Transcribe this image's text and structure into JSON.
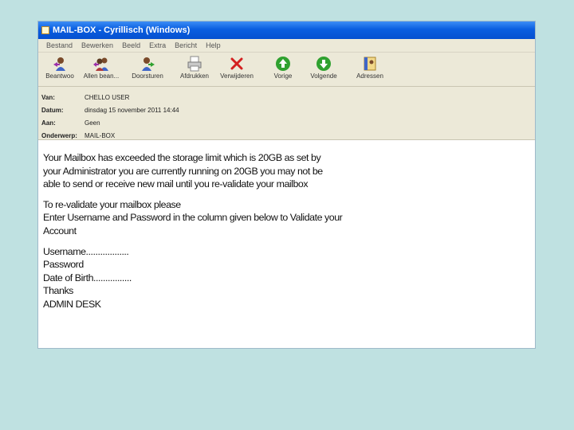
{
  "window": {
    "title": "MAIL-BOX - Cyrillisch (Windows)"
  },
  "menu": [
    "Bestand",
    "Bewerken",
    "Beeld",
    "Extra",
    "Bericht",
    "Help"
  ],
  "toolbar": [
    {
      "label": "Beantwoo",
      "icon": "reply-icon"
    },
    {
      "label": "Allen bean...",
      "icon": "reply-all-icon"
    },
    {
      "label": "Doorsturen",
      "icon": "forward-icon"
    },
    {
      "label": "Afdrukken",
      "icon": "print-icon"
    },
    {
      "label": "Verwijderen",
      "icon": "delete-icon"
    },
    {
      "label": "Vorige",
      "icon": "previous-icon"
    },
    {
      "label": "Volgende",
      "icon": "next-icon"
    },
    {
      "label": "Adressen",
      "icon": "address-book-icon"
    }
  ],
  "header": {
    "from_label": "Van:",
    "from": "CHELLO USER",
    "date_label": "Datum:",
    "date": "dinsdag 15 november 2011 14:44",
    "to_label": "Aan:",
    "to": "Geen",
    "subject_label": "Onderwerp:",
    "subject": "MAIL-BOX"
  },
  "body": {
    "p1": [
      "Your Mailbox has exceeded the storage limit which is 20GB as set by",
      "your Administrator you are currently running on 20GB you may not be",
      "able to send or receive new mail until you re-validate your mailbox"
    ],
    "p2": [
      " To re-validate your mailbox please",
      "Enter Username and Password in the column given below to Validate your",
      " Account"
    ],
    "p3": [
      " Username..................",
      " Password",
      " Date of Birth................",
      " Thanks",
      " ADMIN DESK"
    ]
  },
  "colors": {
    "background": "#bfe1e1",
    "titlebar": "#0a5ee0",
    "chrome": "#ece9d8",
    "arrow_green": "#2fa12f",
    "delete_red": "#d42020"
  }
}
